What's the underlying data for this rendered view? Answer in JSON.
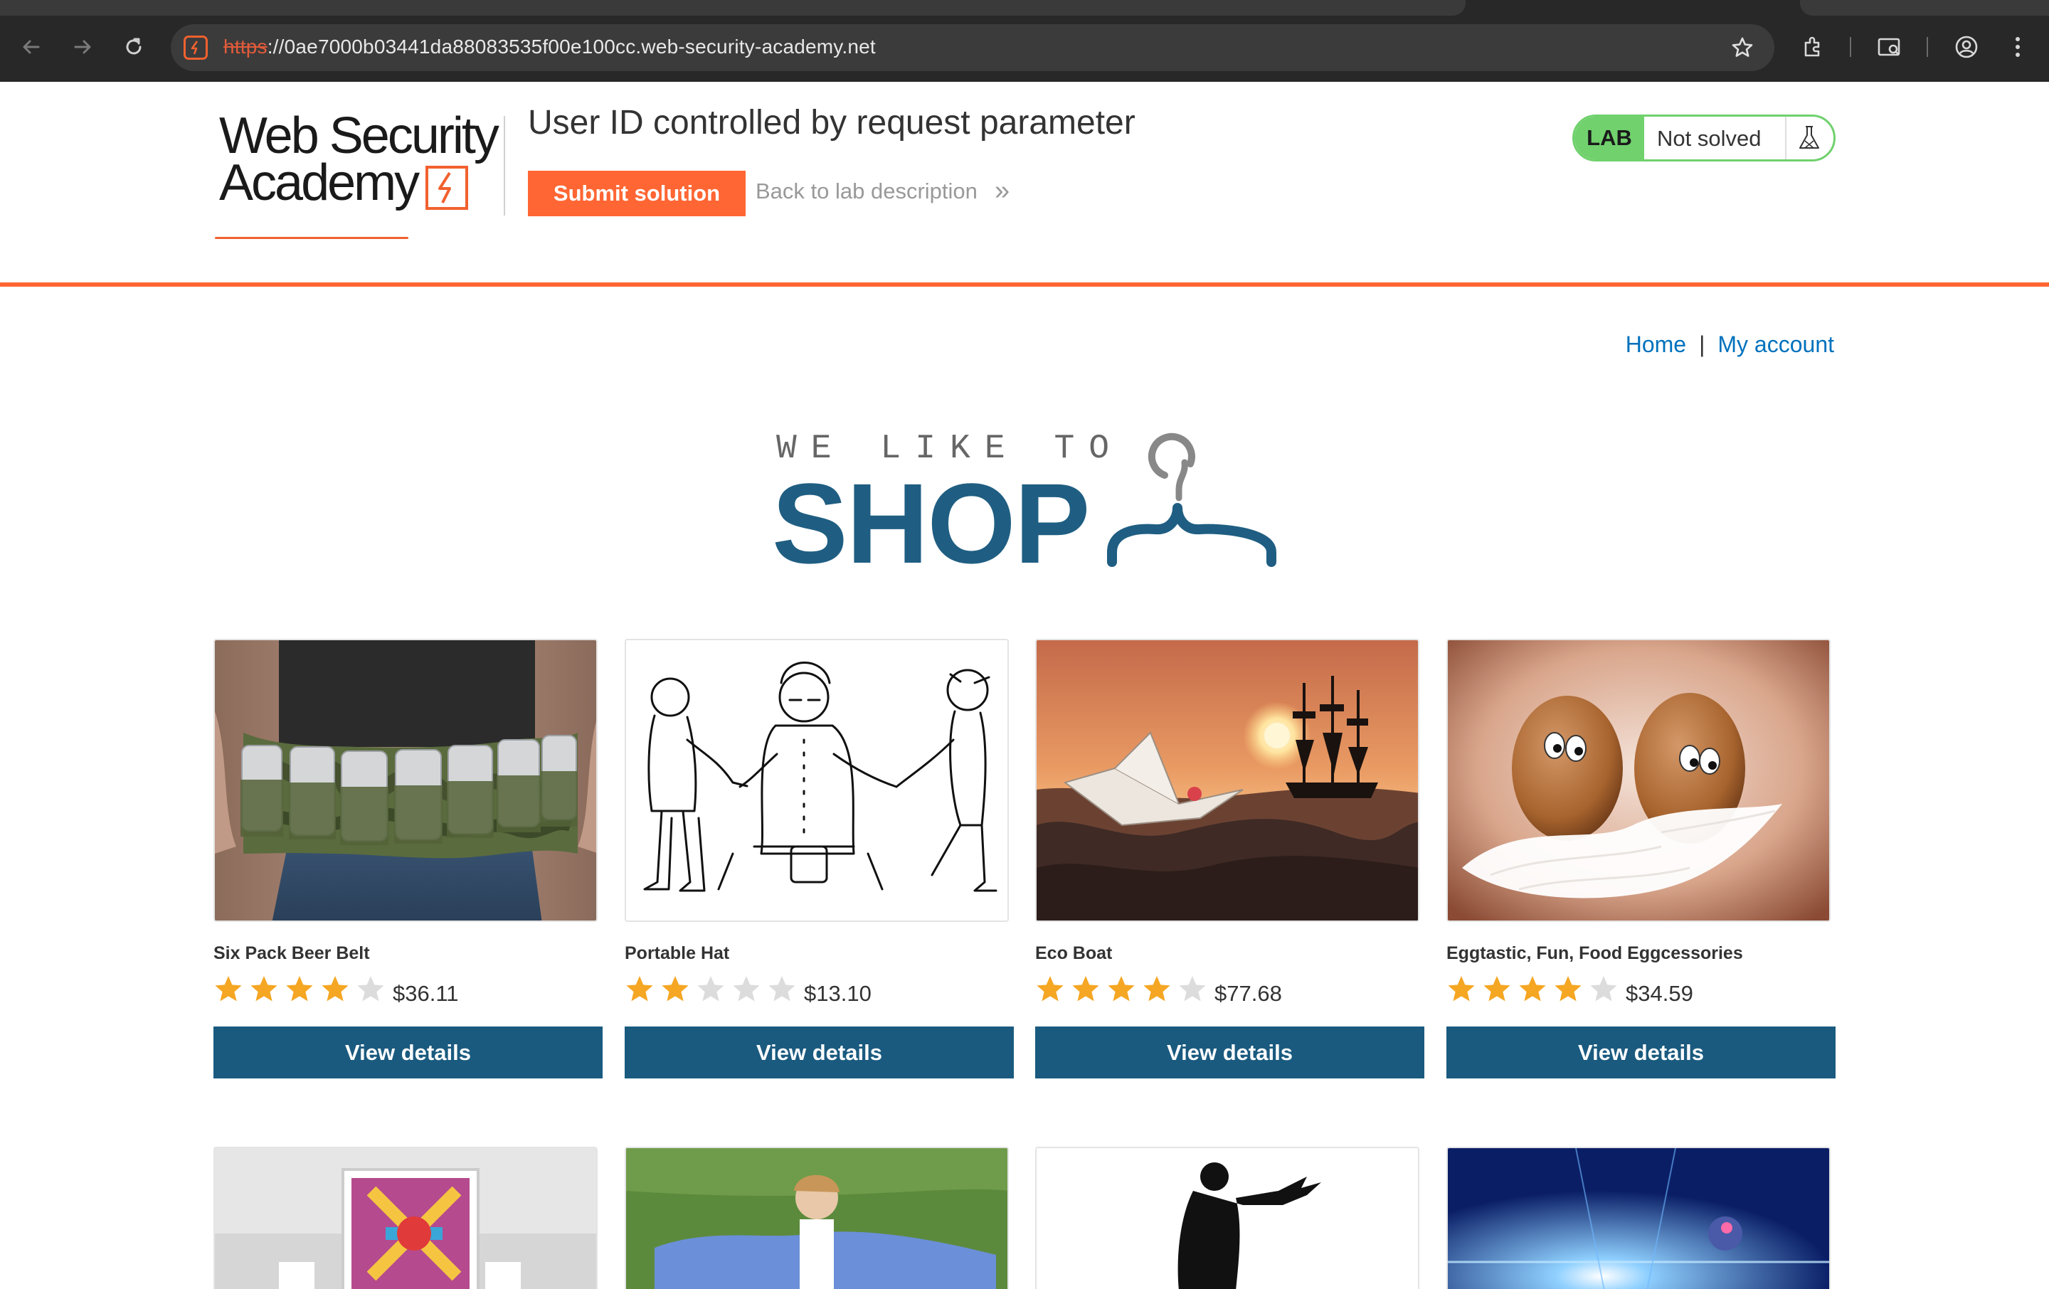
{
  "browser": {
    "url_scheme": "https",
    "url_rest": "://0ae7000b03441da88083535f00e100cc.web-security-academy.net"
  },
  "lab": {
    "logo_line1": "Web Security",
    "logo_line2": "Academy",
    "title": "User ID controlled by request parameter",
    "submit_label": "Submit solution",
    "back_label": "Back to lab description",
    "back_chevron": "»",
    "status_tag": "LAB",
    "status_text": "Not solved",
    "accent_color": "#ff6633",
    "solved_color": "#70d16d"
  },
  "nav": {
    "home": "Home",
    "separator": "|",
    "account": "My account"
  },
  "banner": {
    "line1": "WE LIKE TO",
    "line2": "SHOP"
  },
  "products": [
    {
      "name": "Six Pack Beer Belt",
      "rating": 4,
      "price": "$36.11",
      "button": "View details"
    },
    {
      "name": "Portable Hat",
      "rating": 2,
      "price": "$13.10",
      "button": "View details"
    },
    {
      "name": "Eco Boat",
      "rating": 4,
      "price": "$77.68",
      "button": "View details"
    },
    {
      "name": "Eggtastic, Fun, Food Eggcessories",
      "rating": 4,
      "price": "$34.59",
      "button": "View details"
    }
  ],
  "colors": {
    "brand_blue": "#1a5a7f",
    "link_blue": "#0071bc",
    "star_filled": "#f5a623",
    "star_empty": "#dcdcdc"
  }
}
